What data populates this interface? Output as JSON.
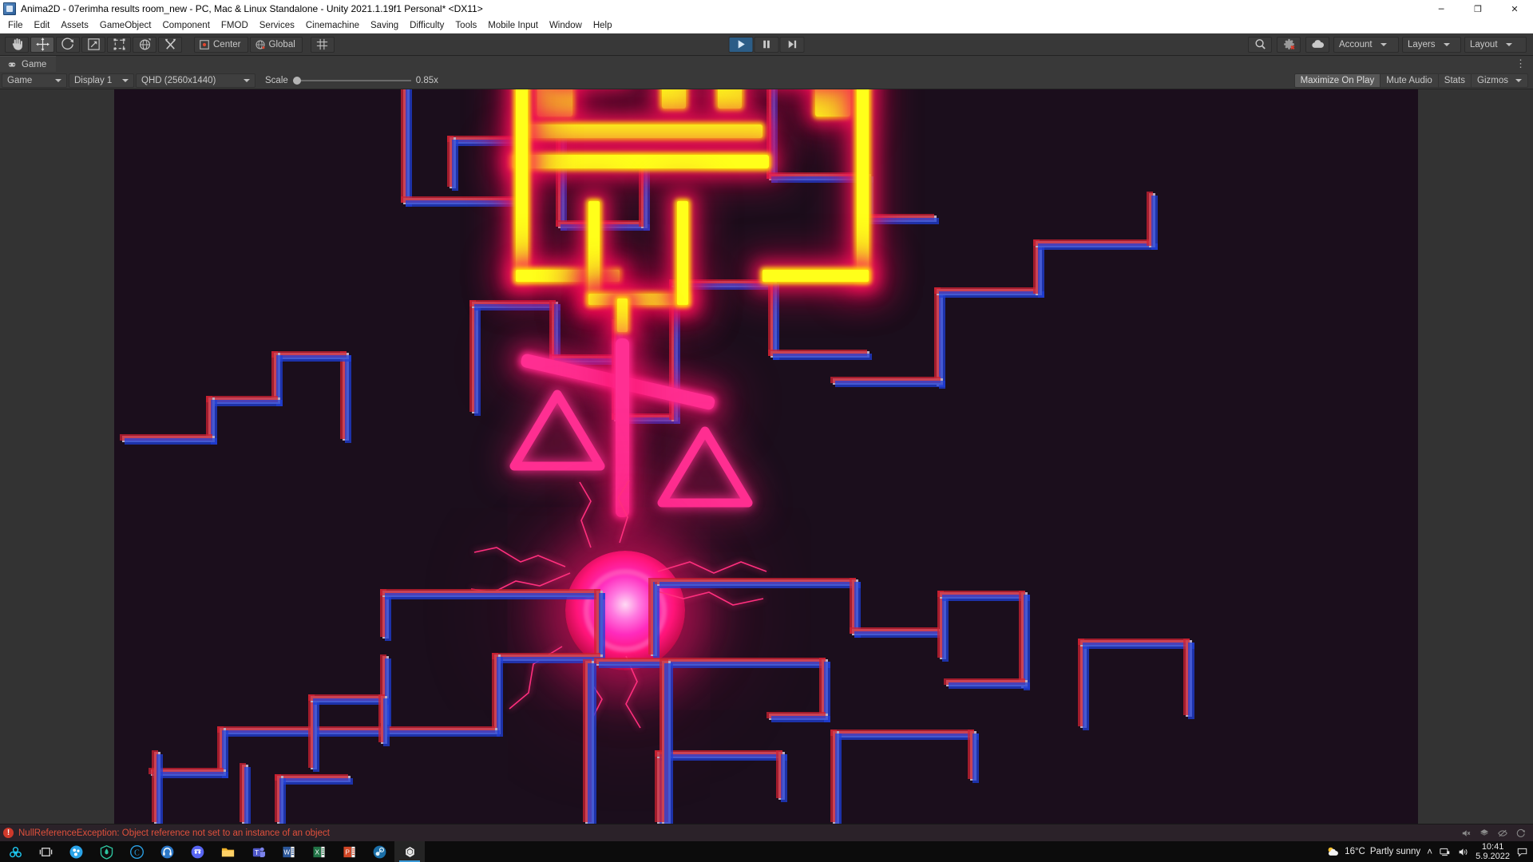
{
  "window": {
    "title": "Anima2D - 07erimha results room_new - PC, Mac & Linux Standalone - Unity 2021.1.19f1 Personal* <DX11>",
    "app_icon": "unity-window-icon",
    "minimize": "─",
    "maximize": "❐",
    "close": "✕"
  },
  "menubar": {
    "items": [
      {
        "label": "File"
      },
      {
        "label": "Edit"
      },
      {
        "label": "Assets"
      },
      {
        "label": "GameObject"
      },
      {
        "label": "Component"
      },
      {
        "label": "FMOD"
      },
      {
        "label": "Services"
      },
      {
        "label": "Cinemachine"
      },
      {
        "label": "Saving"
      },
      {
        "label": "Difficulty"
      },
      {
        "label": "Tools"
      },
      {
        "label": "Mobile Input"
      },
      {
        "label": "Window"
      },
      {
        "label": "Help"
      }
    ]
  },
  "toolbar": {
    "tools": [
      {
        "name": "hand-tool",
        "selected": false
      },
      {
        "name": "move-tool",
        "selected": true
      },
      {
        "name": "rotate-tool",
        "selected": false
      },
      {
        "name": "scale-tool",
        "selected": false
      },
      {
        "name": "rect-transform-tool",
        "selected": false
      },
      {
        "name": "transform-tool",
        "selected": false
      },
      {
        "name": "custom-editor-tool",
        "selected": false
      }
    ],
    "pivot_label": "Center",
    "handle_label": "Global",
    "grid_snap_name": "grid-snapping-icon",
    "play": "▶",
    "pause": "‖",
    "step": "▶|",
    "play_active": true,
    "search_icon": "search-icon",
    "collab_icon": "collab-error-icon",
    "cloud_icon": "cloud-icon",
    "account_label": "Account",
    "layers_label": "Layers",
    "layout_label": "Layout"
  },
  "game_window": {
    "tab_label": "Game",
    "tab_icon": "game-view-icon",
    "tab_menu": "⋮",
    "view_mode": "Game",
    "display": "Display 1",
    "resolution": "QHD (2560x1440)",
    "scale_label": "Scale",
    "scale_value": "0.85x",
    "scale_percent": 0,
    "maximize_on_play": "Maximize On Play",
    "maximize_on_play_active": true,
    "mute_audio": "Mute Audio",
    "stats": "Stats",
    "gizmos": "Gizmos"
  },
  "scene": {
    "background_color": "#1b0e1c",
    "neon_yellow": "#ffff1a",
    "neon_pink": "#ff2f92",
    "orb_color": "#ff2bbd",
    "trace_color": "#b8a8bd",
    "aberration_red": "#d02232",
    "aberration_blue": "#1f3fd8",
    "objects": [
      {
        "name": "neon-crown-sign",
        "color": "#ffff1a"
      },
      {
        "name": "neon-balance-scale",
        "color": "#ff2f92"
      },
      {
        "name": "plasma-orb",
        "color": "#ff2bbd"
      },
      {
        "name": "circuit-trace-pattern",
        "color": "#b8a8bd"
      }
    ]
  },
  "statusbar": {
    "error_badge": "!",
    "message": "NullReferenceException: Object reference not set to an instance of an object",
    "error_color": "#e0503c",
    "right_icons": [
      "mute-icon",
      "layers-status-icon",
      "visibility-off-icon",
      "refresh-icon"
    ]
  },
  "taskbar": {
    "items": [
      {
        "name": "start-button",
        "glyph": "biohazard"
      },
      {
        "name": "task-view-button",
        "glyph": "taskview"
      },
      {
        "name": "taskbar-app-unknown-blue",
        "glyph": "dots"
      },
      {
        "name": "taskbar-app-shield",
        "glyph": "shield"
      },
      {
        "name": "taskbar-app-c",
        "glyph": "c"
      },
      {
        "name": "taskbar-app-headset",
        "glyph": "headset"
      },
      {
        "name": "taskbar-app-discord",
        "glyph": "discord"
      },
      {
        "name": "taskbar-file-explorer",
        "glyph": "folder"
      },
      {
        "name": "taskbar-microsoft-teams",
        "glyph": "T"
      },
      {
        "name": "taskbar-microsoft-word",
        "glyph": "W"
      },
      {
        "name": "taskbar-microsoft-excel",
        "glyph": "X"
      },
      {
        "name": "taskbar-microsoft-powerpoint",
        "glyph": "P"
      },
      {
        "name": "taskbar-steam",
        "glyph": "steam"
      },
      {
        "name": "taskbar-unity",
        "glyph": "unity",
        "active": true
      }
    ],
    "tray": {
      "weather_temp": "16°C",
      "weather_desc": "Partly sunny",
      "chevron": "˄",
      "network_icon": "network-icon",
      "volume_icon": "volume-icon",
      "time": "10:41",
      "date": "5.9.2022",
      "notifications_icon": "notification-icon"
    }
  }
}
